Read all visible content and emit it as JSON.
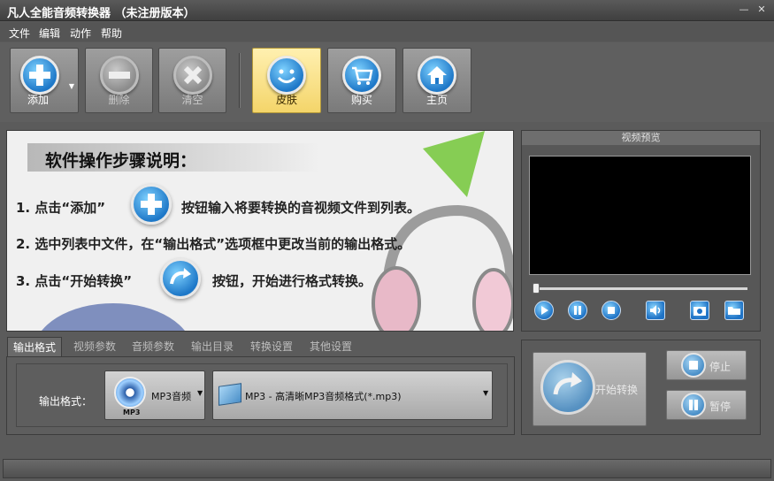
{
  "window": {
    "title": "凡人全能音频转换器 （未注册版本）",
    "minimize_label": "—",
    "close_label": "✕"
  },
  "menu": [
    "文件",
    "编辑",
    "动作",
    "帮助"
  ],
  "toolbar": {
    "add_label": "添加",
    "delete_label": "删除",
    "clear_label": "清空",
    "skin_label": "皮肤",
    "buy_label": "购买",
    "home_label": "主页",
    "dropdown_glyph": "▼"
  },
  "instructions": {
    "heading": "软件操作步骤说明：",
    "step1_before": "1. 点击“添加”",
    "step1_after": "按钮输入将要转换的音视频文件到列表。",
    "step2": "2. 选中列表中文件，在“输出格式”选项框中更改当前的输出格式。",
    "step3_before": "3. 点击“开始转换”",
    "step3_after": "按钮，开始进行格式转换。"
  },
  "preview": {
    "title": "视频预览",
    "seek_position": 0
  },
  "tabs": [
    {
      "label": "输出格式",
      "active": true
    },
    {
      "label": "视频参数",
      "active": false
    },
    {
      "label": "音频参数",
      "active": false
    },
    {
      "label": "输出目录",
      "active": false
    },
    {
      "label": "转换设置",
      "active": false
    },
    {
      "label": "其他设置",
      "active": false
    }
  ],
  "output": {
    "format_label": "输出格式：",
    "type_value": "MP3音频",
    "type_icon_label": "MP3",
    "profile_value": "MP3 - 高清晰MP3音频格式(*.mp3)",
    "arrow": "▼"
  },
  "actions": {
    "start_label": "开始转换",
    "stop_label": "停止",
    "pause_label": "暂停"
  },
  "colors": {
    "background": "#5b5b5b",
    "accent_blue": "#1e78c8",
    "skin_active": "#f4d56a"
  }
}
